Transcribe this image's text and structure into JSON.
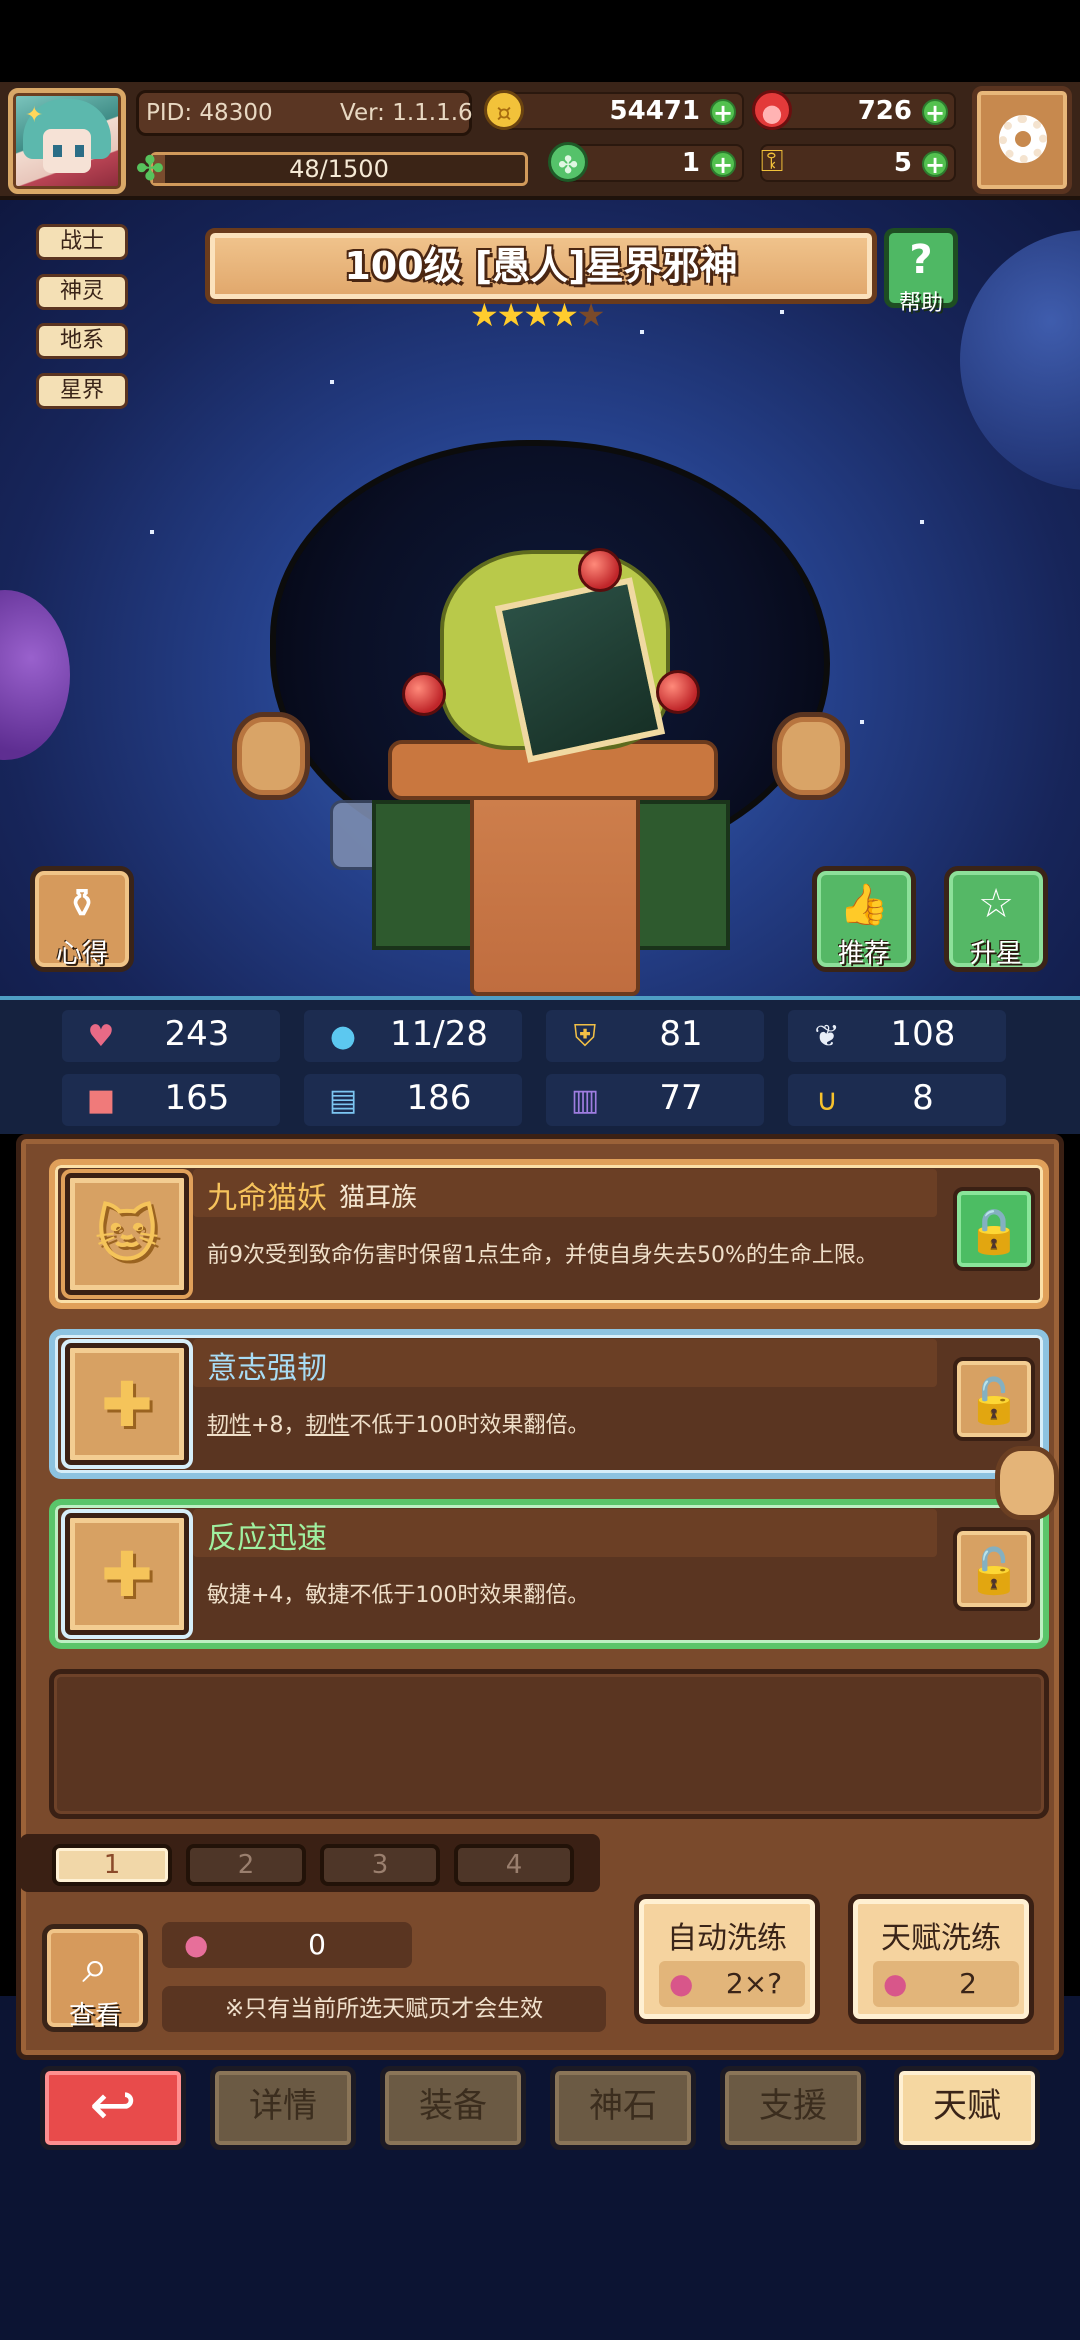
{
  "header": {
    "pid_label": "PID: 48300",
    "version_label": "Ver: 1.1.1.6",
    "exp_text": "48/1500",
    "exp_fraction": 0.032,
    "gold": "54471",
    "gem": "726",
    "clover": "1",
    "key": "5"
  },
  "hero": {
    "name": "100级 [愚人]星界邪神",
    "stars_filled": 4,
    "stars_total": 5,
    "tags": [
      "战士",
      "神灵",
      "地系",
      "星界"
    ],
    "help_label": "帮助",
    "insight_label": "心得",
    "recommend_label": "推荐",
    "star_up_label": "升星"
  },
  "stats": [
    {
      "icon": "heart-icon",
      "value": "243",
      "color": "#e86a86",
      "glyph": "♥"
    },
    {
      "icon": "mana-drop-icon",
      "value": "11/28",
      "color": "#5cc8f0",
      "glyph": "💧"
    },
    {
      "icon": "shield-icon",
      "value": "81",
      "color": "#f2c046",
      "glyph": "⛨"
    },
    {
      "icon": "wing-icon",
      "value": "108",
      "color": "#e8eef8",
      "glyph": "❦"
    },
    {
      "icon": "fist-icon",
      "value": "165",
      "color": "#f07a7a",
      "glyph": "✊"
    },
    {
      "icon": "book-icon",
      "value": "186",
      "color": "#7cc6f2",
      "glyph": "▤"
    },
    {
      "icon": "scroll-icon",
      "value": "77",
      "color": "#9f7de0",
      "glyph": "▥"
    },
    {
      "icon": "horseshoe-icon",
      "value": "8",
      "color": "#f7c22c",
      "glyph": "∪"
    }
  ],
  "talents": [
    {
      "name": "九命猫妖",
      "tribe": "猫耳族",
      "desc": "前9次受到致命伤害时保留1点生命，并使自身失去50%的生命上限。",
      "locked": true,
      "icon": "cat-icon"
    },
    {
      "name": "意志强韧",
      "desc_parts": [
        "韧性",
        "+8，",
        "韧性",
        "不低于100时效果翻倍。"
      ],
      "locked": false,
      "icon": "cross-icon"
    },
    {
      "name": "反应迅速",
      "desc": "敏捷+4，敏捷不低于100时效果翻倍。",
      "locked": false,
      "icon": "cross-icon"
    }
  ],
  "pages": [
    "1",
    "2",
    "3",
    "4"
  ],
  "active_page": 0,
  "bottom": {
    "view_label": "查看",
    "potion_count": "0",
    "note": "※只有当前所选天赋页才会生效",
    "auto_wash_label": "自动洗练",
    "auto_wash_cost": "2×?",
    "talent_wash_label": "天赋洗练",
    "talent_wash_cost": "2"
  },
  "nav": {
    "back_glyph": "↩",
    "tabs": [
      "详情",
      "装备",
      "神石",
      "支援",
      "天赋"
    ],
    "active": 4
  },
  "colors": {
    "panel_brown": "#7a4a2c",
    "gold_accent": "#e0a05a",
    "green_accent": "#55b866",
    "red_back": "#e84b4b"
  }
}
